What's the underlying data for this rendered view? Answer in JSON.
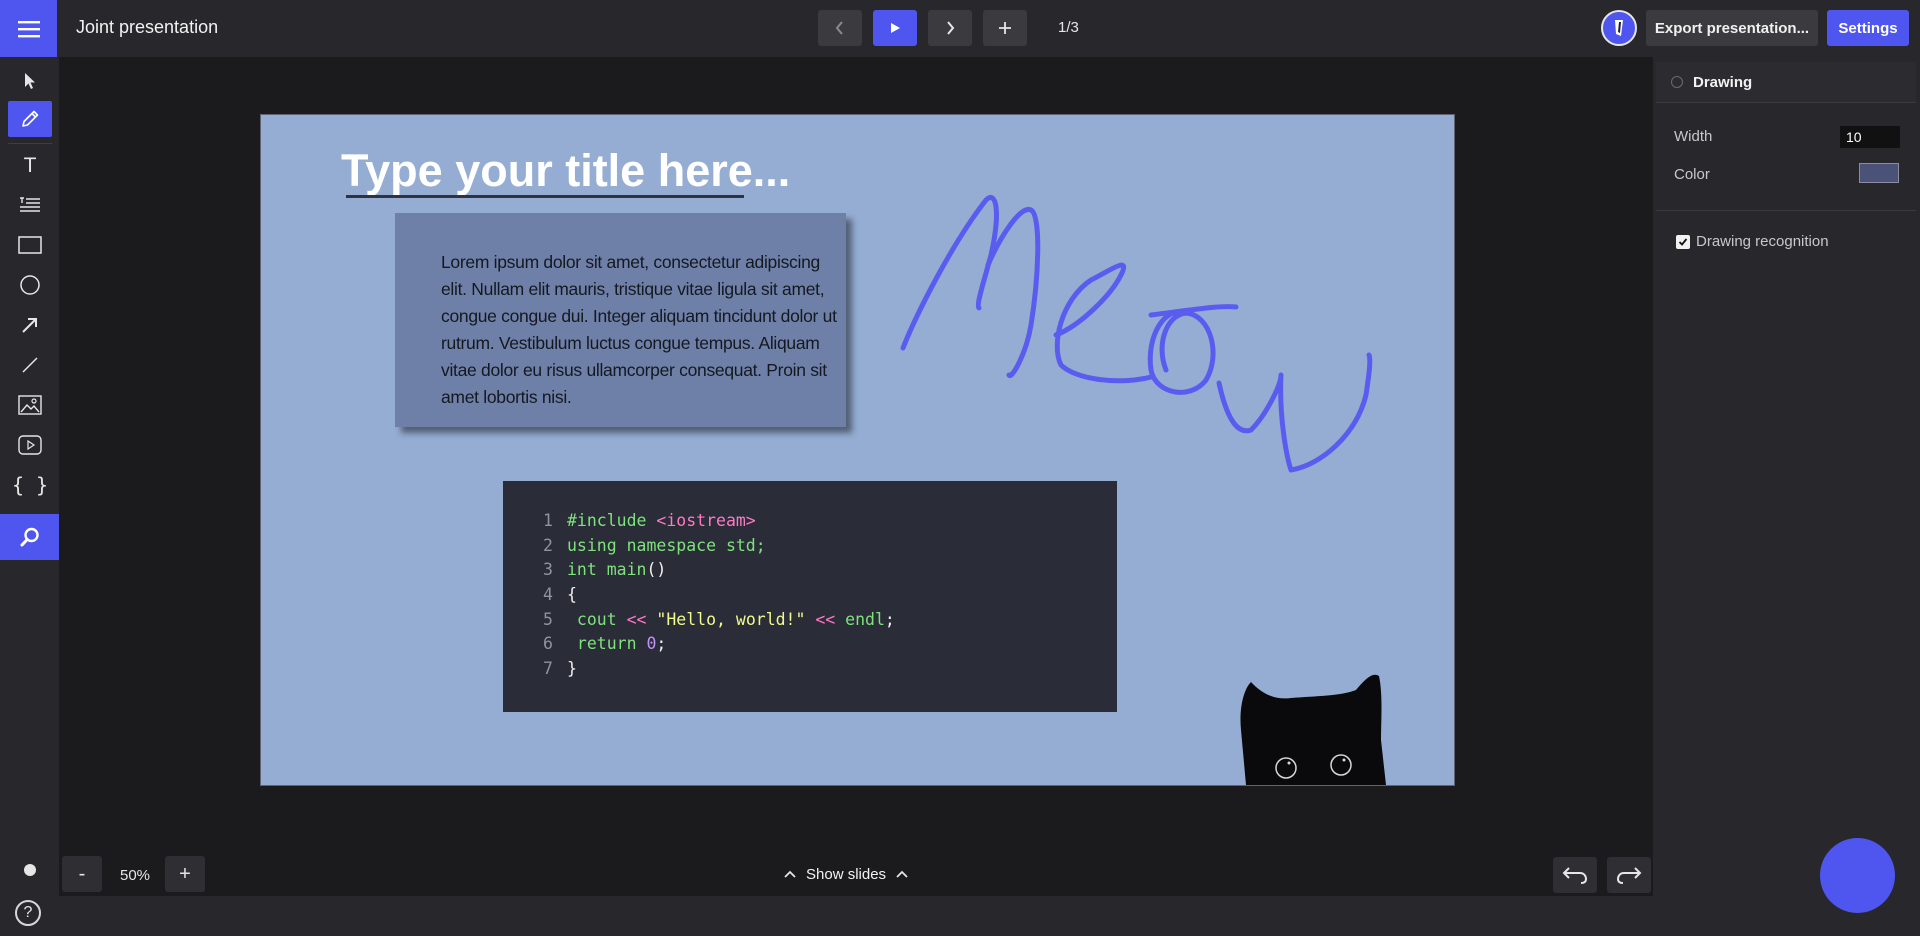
{
  "app": {
    "title": "Joint presentation"
  },
  "header": {
    "page_counter": "1/3",
    "export_label": "Export presentation...",
    "settings_label": "Settings"
  },
  "toolbar": {
    "tools": [
      "select-icon",
      "pen-icon",
      "text-icon",
      "list-icon",
      "rectangle-icon",
      "circle-icon",
      "arrow-icon",
      "line-icon",
      "image-icon",
      "video-icon",
      "code-icon",
      "search-icon"
    ],
    "code_glyph": "{ }",
    "text_glyph": "T"
  },
  "slide": {
    "title": "Type your title here...",
    "lorem": "Lorem ipsum dolor sit amet, consectetur adipiscing elit. Nullam elit mauris, tristique vitae ligula sit amet, congue congue dui. Integer aliquam tincidunt dolor ut rutrum. Vestibulum luctus congue tempus. Aliquam vitae dolor eu risus ullamcorper consequat. Proin sit amet lobortis nisi.",
    "code": {
      "line_numbers": [
        "1",
        "2",
        "3",
        "4",
        "5",
        "6",
        "7"
      ],
      "l1_a": "#include ",
      "l1_b": "<iostream>",
      "l2": "using namespace std;",
      "l3_a": "int ",
      "l3_b": "main",
      "l3_c": "()",
      "l4": "{",
      "l5_a": " cout ",
      "l5_b": "<<",
      "l5_c": " \"Hello, world!\" ",
      "l5_d": "<<",
      "l5_e": " endl",
      "l5_f": ";",
      "l6_a": " return ",
      "l6_b": "0",
      "l6_c": ";",
      "l7": "}"
    },
    "drawing_color": "#5a5cf0",
    "background_color": "#95add3"
  },
  "panel": {
    "section_title": "Drawing",
    "width_label": "Width",
    "width_value": "10",
    "color_label": "Color",
    "color_value": "#4b5278",
    "recognition_label": "Drawing recognition",
    "recognition_checked": true
  },
  "bottom": {
    "zoom_out": "-",
    "zoom_level": "50%",
    "zoom_in": "+",
    "show_slides_label": "Show slides",
    "help": "?"
  },
  "colors": {
    "accent": "#4f56f0",
    "panel": "#28282c",
    "canvas": "#1b1b1d"
  }
}
